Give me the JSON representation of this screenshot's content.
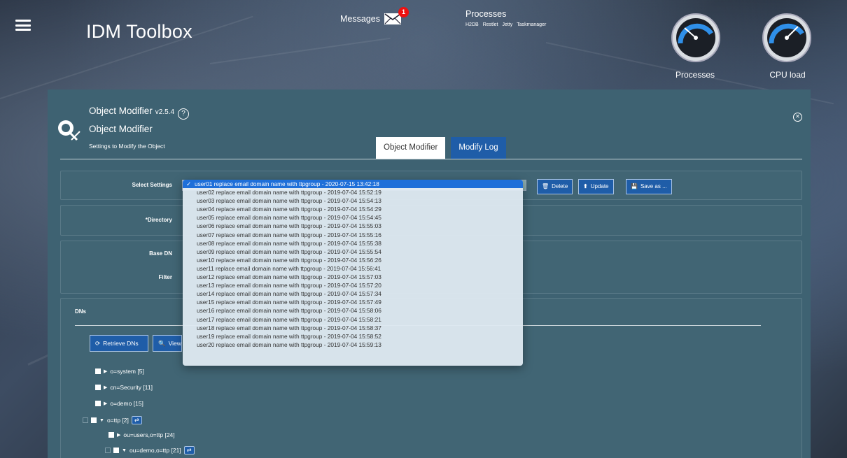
{
  "header": {
    "app_title": "IDM Toolbox",
    "messages_label": "Messages",
    "messages_count": "1",
    "processes_title": "Processes",
    "process_links": [
      "H2DB",
      "Restlet",
      "Jetty",
      "Taskmanager"
    ],
    "gauges": [
      {
        "label": "Processes",
        "icon": "gauge-icon"
      },
      {
        "label": "CPU load",
        "icon": "gauge-icon"
      }
    ]
  },
  "panel": {
    "title": "Object Modifier",
    "version": "v2.5.4",
    "subtitle": "Object Modifier",
    "description": "Settings to Modify the Object",
    "tabs": [
      {
        "label": "Object Modifier",
        "active": true
      },
      {
        "label": "Modify Log",
        "active": false
      }
    ]
  },
  "form": {
    "select_settings_label": "Select Settings",
    "directory_label": "*Directory",
    "base_dn_label": "Base DN",
    "filter_label": "Filter",
    "delete_label": "Delete",
    "update_label": "Update",
    "save_as_label": "Save as ..."
  },
  "settings_options": [
    "user01 replace email domain name with ttpgroup - 2020-07-15 13:42:18",
    "user02 replace email domain name with ttpgroup - 2019-07-04 15:52:19",
    "user03 replace email domain name with ttpgroup - 2019-07-04 15:54:13",
    "user04 replace email domain name with ttpgroup - 2019-07-04 15:54:29",
    "user05 replace email domain name with ttpgroup - 2019-07-04 15:54:45",
    "user06 replace email domain name with ttpgroup - 2019-07-04 15:55:03",
    "user07 replace email domain name with ttpgroup - 2019-07-04 15:55:16",
    "user08 replace email domain name with ttpgroup - 2019-07-04 15:55:38",
    "user09 replace email domain name with ttpgroup - 2019-07-04 15:55:54",
    "user10 replace email domain name with ttpgroup - 2019-07-04 15:56:26",
    "user11 replace email domain name with ttpgroup - 2019-07-04 15:56:41",
    "user12 replace email domain name with ttpgroup - 2019-07-04 15:57:03",
    "user13 replace email domain name with ttpgroup - 2019-07-04 15:57:20",
    "user14 replace email domain name with ttpgroup - 2019-07-04 15:57:34",
    "user15 replace email domain name with ttpgroup - 2019-07-04 15:57:49",
    "user16 replace email domain name with ttpgroup - 2019-07-04 15:58:06",
    "user17 replace email domain name with ttpgroup - 2019-07-04 15:58:21",
    "user18 replace email domain name with ttpgroup - 2019-07-04 15:58:37",
    "user19 replace email domain name with ttpgroup - 2019-07-04 15:58:52",
    "user20 replace email domain name with ttpgroup - 2019-07-04 15:59:13"
  ],
  "selected_index": 0,
  "dns": {
    "label": "DNs",
    "retrieve_label": "Retrieve DNs",
    "view_label": "View",
    "tree": [
      {
        "label": "o=system [5]",
        "expanded": false
      },
      {
        "label": "cn=Security [11]",
        "expanded": false
      },
      {
        "label": "o=demo [15]",
        "expanded": false
      },
      {
        "label": "o=ttp [2]",
        "expanded": true
      },
      {
        "label": "ou=users,o=ttp [24]",
        "expanded": false
      },
      {
        "label": "ou=demo,o=ttp [21]",
        "expanded": true
      }
    ]
  },
  "colors": {
    "panel_bg": "#3e6272",
    "button_blue": "#1f5da8",
    "selected_option": "#1e6fd9",
    "badge_red": "#ee1111"
  }
}
